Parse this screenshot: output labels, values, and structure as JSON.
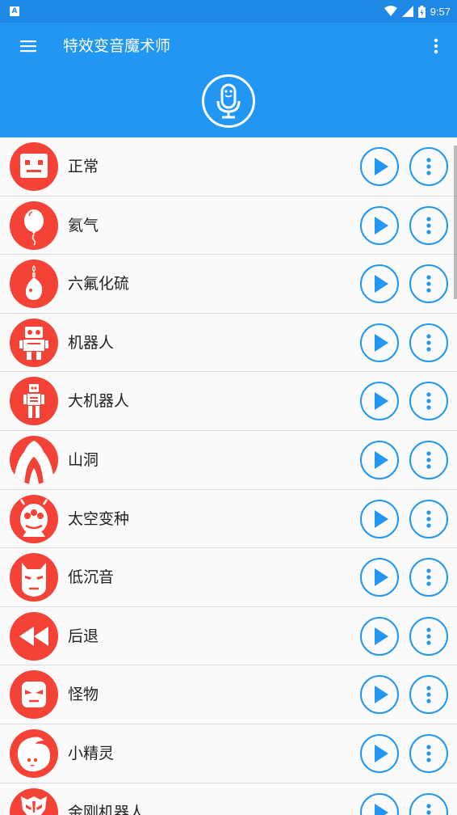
{
  "status_bar": {
    "time": "9:57",
    "notification_icon": "a-icon",
    "icons": [
      "wifi-icon",
      "signal-icon",
      "battery-icon"
    ]
  },
  "app_bar": {
    "title": "特效变音魔术师",
    "menu_icon": "hamburger-menu-icon",
    "more_icon": "more-vertical-icon",
    "center_icon": "microphone-icon"
  },
  "colors": {
    "primary": "#2196f3",
    "primary_dark": "#1e88e5",
    "avatar": "#f44336",
    "background": "#fafafa"
  },
  "effects": [
    {
      "label": "正常",
      "icon": "robot-face-icon"
    },
    {
      "label": "氦气",
      "icon": "balloon-icon"
    },
    {
      "label": "六氟化硫",
      "icon": "gas-bubble-icon"
    },
    {
      "label": "机器人",
      "icon": "robot-icon"
    },
    {
      "label": "大机器人",
      "icon": "big-robot-icon"
    },
    {
      "label": "山洞",
      "icon": "cave-icon"
    },
    {
      "label": "太空变种",
      "icon": "alien-icon"
    },
    {
      "label": "低沉音",
      "icon": "bat-mask-icon"
    },
    {
      "label": "后退",
      "icon": "rewind-icon"
    },
    {
      "label": "怪物",
      "icon": "monster-icon"
    },
    {
      "label": "小精灵",
      "icon": "elf-icon"
    },
    {
      "label": "金刚机器人",
      "icon": "transformer-icon"
    }
  ],
  "row_actions": {
    "play_icon": "play-icon",
    "options_icon": "more-vertical-icon"
  }
}
